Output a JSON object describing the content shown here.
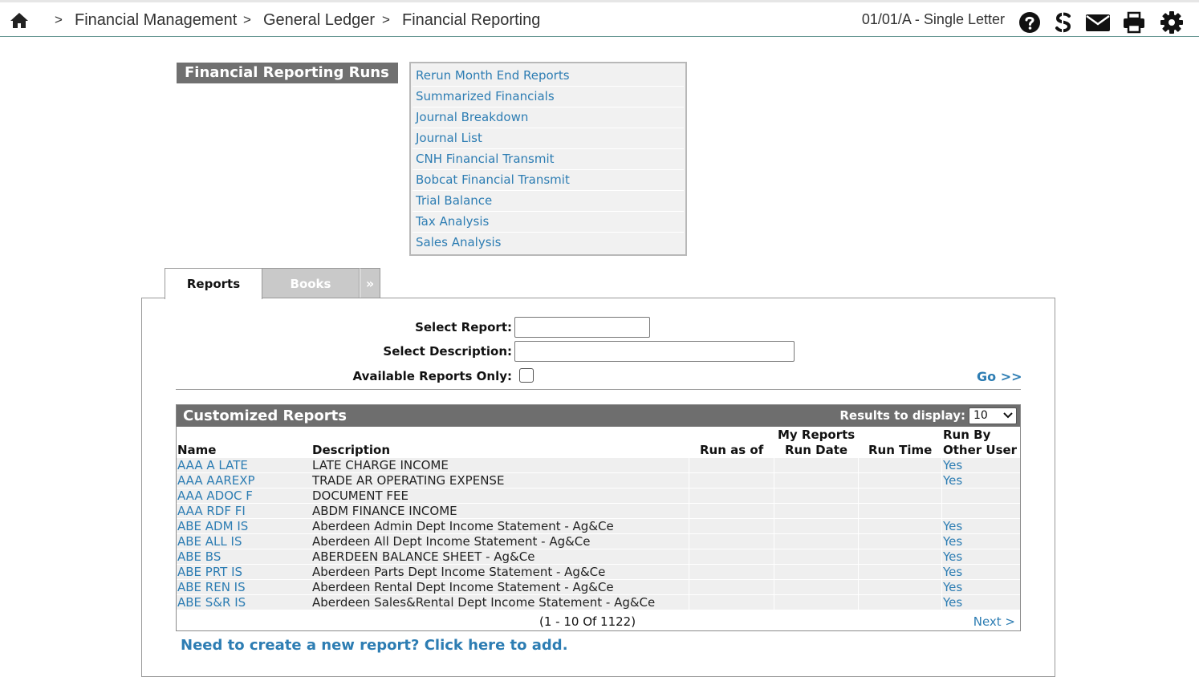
{
  "header": {
    "breadcrumb": [
      "Financial Management",
      "General Ledger",
      "Financial Reporting"
    ],
    "separator": ">",
    "branch": "01/01/A - Single Letter",
    "icons": [
      "home-icon",
      "help-icon",
      "s-icon",
      "mail-icon",
      "print-icon",
      "settings-icon"
    ]
  },
  "runs": {
    "title": "Financial Reporting Runs",
    "items": [
      "Rerun Month End Reports",
      "Summarized Financials",
      "Journal Breakdown",
      "Journal List",
      "CNH Financial Transmit",
      "Bobcat Financial Transmit",
      "Trial Balance",
      "Tax Analysis",
      "Sales Analysis"
    ]
  },
  "tabs": {
    "reports": "Reports",
    "books": "Books",
    "more": "»"
  },
  "filters": {
    "report_label": "Select Report:",
    "report_value": "",
    "description_label": "Select Description:",
    "description_value": "",
    "available_label": "Available Reports Only:",
    "available_checked": false,
    "go": "Go >>"
  },
  "grid": {
    "title": "Customized Reports",
    "results_label": "Results to display:",
    "results_value": "10",
    "columns": {
      "name": "Name",
      "description": "Description",
      "run_as_of": "Run as of",
      "my_reports_line1": "My Reports",
      "my_reports_line2": "Run Date",
      "run_time": "Run Time",
      "run_by_line1": "Run By",
      "run_by_line2": "Other User"
    },
    "rows": [
      {
        "name": "AAA A LATE",
        "description": "LATE CHARGE INCOME",
        "run_as_of": "",
        "run_date": "",
        "run_time": "",
        "run_by": "Yes"
      },
      {
        "name": "AAA AAREXP",
        "description": "TRADE AR OPERATING EXPENSE",
        "run_as_of": "",
        "run_date": "",
        "run_time": "",
        "run_by": "Yes"
      },
      {
        "name": "AAA ADOC F",
        "description": "DOCUMENT FEE",
        "run_as_of": "",
        "run_date": "",
        "run_time": "",
        "run_by": ""
      },
      {
        "name": "AAA RDF FI",
        "description": "ABDM FINANCE INCOME",
        "run_as_of": "",
        "run_date": "",
        "run_time": "",
        "run_by": ""
      },
      {
        "name": "ABE ADM IS",
        "description": "Aberdeen Admin Dept Income Statement - Ag&Ce",
        "run_as_of": "",
        "run_date": "",
        "run_time": "",
        "run_by": "Yes"
      },
      {
        "name": "ABE ALL IS",
        "description": "Aberdeen All Dept Income Statement - Ag&Ce",
        "run_as_of": "",
        "run_date": "",
        "run_time": "",
        "run_by": "Yes"
      },
      {
        "name": "ABE BS",
        "description": "ABERDEEN BALANCE SHEET - Ag&Ce",
        "run_as_of": "",
        "run_date": "",
        "run_time": "",
        "run_by": "Yes"
      },
      {
        "name": "ABE PRT IS",
        "description": "Aberdeen Parts Dept Income Statement - Ag&Ce",
        "run_as_of": "",
        "run_date": "",
        "run_time": "",
        "run_by": "Yes"
      },
      {
        "name": "ABE REN IS",
        "description": "Aberdeen Rental Dept Income Statement - Ag&Ce",
        "run_as_of": "",
        "run_date": "",
        "run_time": "",
        "run_by": "Yes"
      },
      {
        "name": "ABE S&R IS",
        "description": "Aberdeen Sales&Rental Dept Income Statement - Ag&Ce",
        "run_as_of": "",
        "run_date": "",
        "run_time": "",
        "run_by": "Yes"
      }
    ],
    "pager": "(1  -  10  Of  1122)",
    "next": "Next >"
  },
  "add_link": "Need to create a new report? Click here to add.",
  "colors": {
    "link": "#2d7db3",
    "header_bar": "#6e6e6e",
    "row_bg": "#efefef",
    "topbar_rule": "#6a9a96"
  }
}
